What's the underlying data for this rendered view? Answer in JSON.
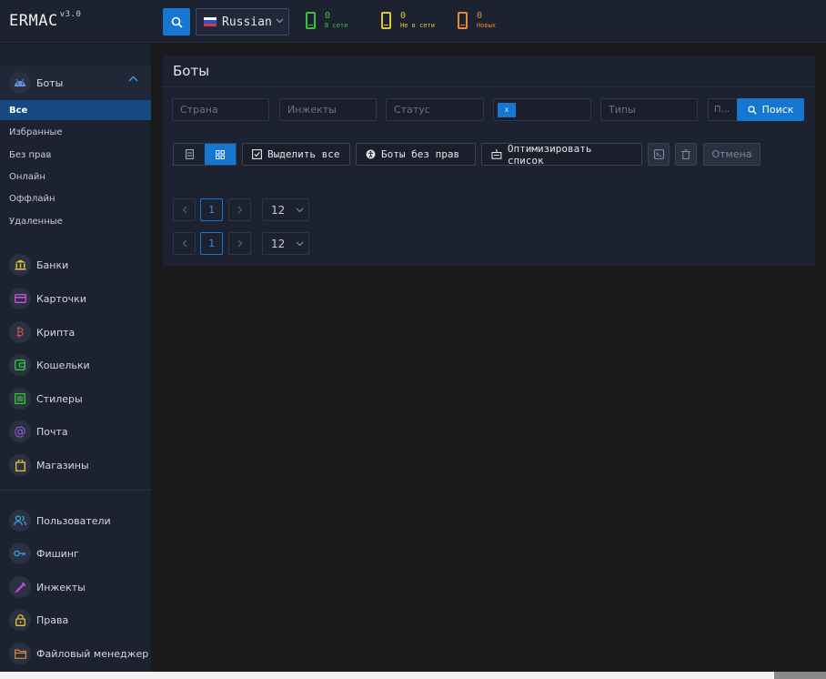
{
  "header": {
    "logo": "ERMAC",
    "version": "v3.0",
    "language": "Russian",
    "stats": [
      {
        "count": "0",
        "label": "В сети",
        "color": "#3fbf3f"
      },
      {
        "count": "0",
        "label": "Не в сети",
        "color": "#e6c43a"
      },
      {
        "count": "0",
        "label": "Новых",
        "color": "#e68a3a"
      }
    ]
  },
  "sidebar": {
    "bots": {
      "label": "Боты",
      "subitems": [
        "Все",
        "Избранные",
        "Без прав",
        "Онлайн",
        "Оффлайн",
        "Удаленные"
      ],
      "active": "Все"
    },
    "items": [
      {
        "label": "Банки",
        "icon": "bank-icon",
        "color": "#e6c43a"
      },
      {
        "label": "Карточки",
        "icon": "card-icon",
        "color": "#c64fd6"
      },
      {
        "label": "Крипта",
        "icon": "bitcoin-icon",
        "color": "#e0524f"
      },
      {
        "label": "Кошельки",
        "icon": "wallet-icon",
        "color": "#3fbf3f"
      },
      {
        "label": "Стилеры",
        "icon": "list-icon",
        "color": "#3fbf3f"
      },
      {
        "label": "Почта",
        "icon": "at-icon",
        "color": "#9a64e0"
      },
      {
        "label": "Магазины",
        "icon": "bag-icon",
        "color": "#e6c43a"
      }
    ],
    "items2": [
      {
        "label": "Пользователи",
        "icon": "users-icon",
        "color": "#3aa5e6"
      },
      {
        "label": "Фишинг",
        "icon": "key-icon",
        "color": "#3aa5e6"
      },
      {
        "label": "Инжекты",
        "icon": "syringe-icon",
        "color": "#c64fd6"
      },
      {
        "label": "Права",
        "icon": "lock-icon",
        "color": "#e6c43a"
      },
      {
        "label": "Файловый менеджер",
        "icon": "folder-icon",
        "color": "#e68a3a"
      }
    ]
  },
  "main": {
    "title": "Боты",
    "filters": {
      "country": "Страна",
      "injects": "Инжекты",
      "status": "Статус",
      "tag": "x",
      "types": "Типы",
      "short": "П...",
      "search": "Поиск"
    },
    "actions": {
      "select_all": "Выделить все",
      "bots_no_rights": "Боты без прав",
      "optimize": "Оптимизировать список",
      "cancel": "Отмена"
    },
    "pagination": {
      "page": "1",
      "page_size": "12"
    }
  },
  "colors": {
    "accent": "#1677d2"
  }
}
